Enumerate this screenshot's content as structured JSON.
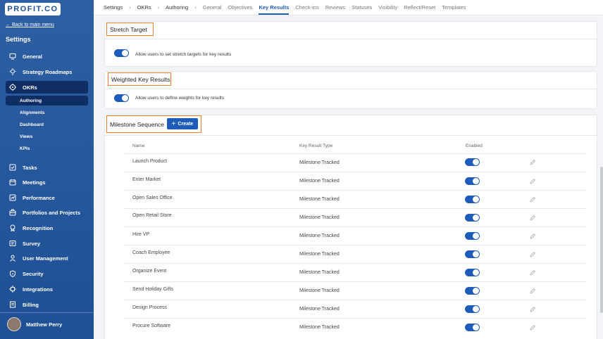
{
  "sidebar": {
    "logo": "PROFIT.CO",
    "back_link": "← Back to main menu",
    "heading": "Settings",
    "items": [
      {
        "label": "General",
        "icon": "monitor-icon"
      },
      {
        "label": "Strategy Roadmaps",
        "icon": "lightbulb-icon"
      },
      {
        "label": "OKRs",
        "icon": "target-icon"
      },
      {
        "label": "Tasks",
        "icon": "checkbox-icon"
      },
      {
        "label": "Meetings",
        "icon": "calendar-icon"
      },
      {
        "label": "Performance",
        "icon": "chart-icon"
      },
      {
        "label": "Portfolios and Projects",
        "icon": "briefcase-icon"
      },
      {
        "label": "Recognition",
        "icon": "award-icon"
      },
      {
        "label": "Survey",
        "icon": "survey-icon"
      },
      {
        "label": "User Management",
        "icon": "user-icon"
      },
      {
        "label": "Security",
        "icon": "shield-icon"
      },
      {
        "label": "Integrations",
        "icon": "plug-icon"
      },
      {
        "label": "Billing",
        "icon": "document-icon"
      }
    ],
    "subitems": [
      "Authoring",
      "Alignments",
      "Dashboard",
      "Views",
      "KPIs"
    ],
    "user": "Matthew Perry"
  },
  "breadcrumb": {
    "settings": "Settings",
    "okrs": "OKRs",
    "authoring": "Authoring",
    "sep": "›"
  },
  "tabs": [
    "General",
    "Objectives",
    "Key Results",
    "Check-ins",
    "Reviews",
    "Statuses",
    "Visibility",
    "Reflect/Reset",
    "Templates"
  ],
  "stretch": {
    "title": "Stretch Target",
    "toggle_label": "Allow users to set stretch targets for key results"
  },
  "weighted": {
    "title": "Weighted Key Results",
    "toggle_label": "Allow users to define weights for key results"
  },
  "milestone": {
    "title": "Milestone Sequence",
    "create": "Create",
    "plus": "+",
    "columns": {
      "name": "Name",
      "type": "Key Result Type",
      "enabled": "Enabled"
    },
    "rows": [
      {
        "name": "Launch Product",
        "type": "Milestone Tracked"
      },
      {
        "name": "Enter Market",
        "type": "Milestone Tracked"
      },
      {
        "name": "Open Sales Office",
        "type": "Milestone Tracked"
      },
      {
        "name": "Open Retail Store",
        "type": "Milestone Tracked"
      },
      {
        "name": "Hire VP",
        "type": "Milestone Tracked"
      },
      {
        "name": "Coach Employee",
        "type": "Milestone Tracked"
      },
      {
        "name": "Organize Event",
        "type": "Milestone Tracked"
      },
      {
        "name": "Send Holiday Gifts",
        "type": "Milestone Tracked"
      },
      {
        "name": "Design Process",
        "type": "Milestone Tracked"
      },
      {
        "name": "Procure Software",
        "type": "Milestone Tracked"
      }
    ]
  },
  "colors": {
    "accent": "#1f5bb8",
    "highlight": "#ef7f2a",
    "sidebar": "#2e5fa3"
  }
}
